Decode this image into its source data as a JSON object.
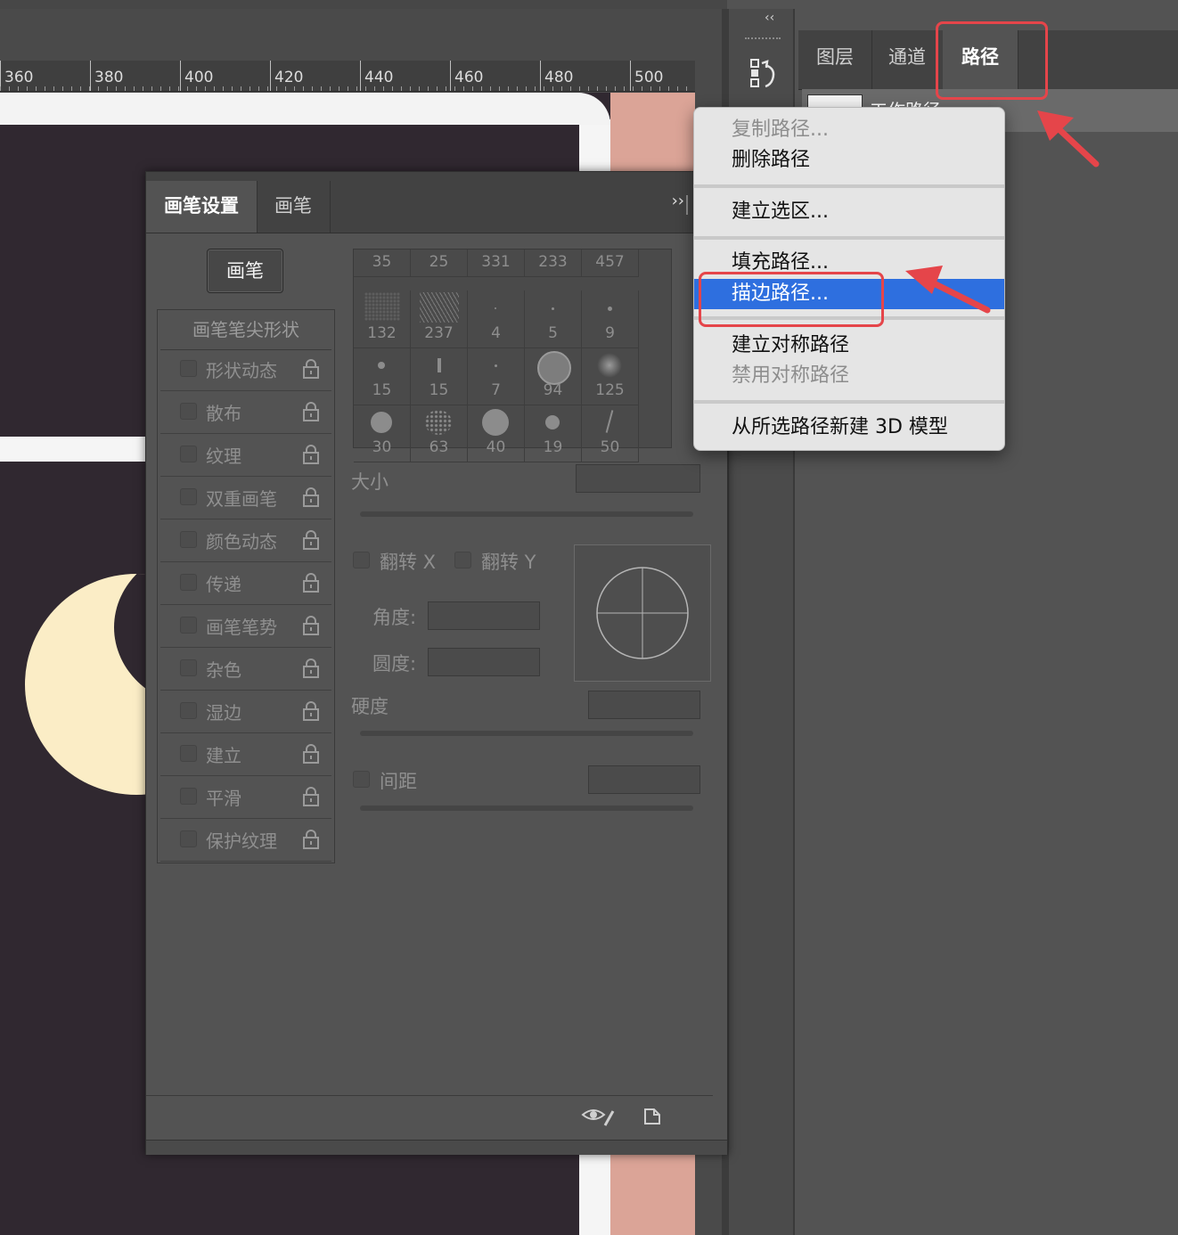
{
  "ruler": {
    "labels": [
      "360",
      "380",
      "400",
      "420",
      "440",
      "460",
      "480",
      "500"
    ]
  },
  "right_panel": {
    "collapse_glyph": "‹‹",
    "history_icon": "history-icon",
    "tabs": [
      {
        "label": "图层"
      },
      {
        "label": "通道"
      },
      {
        "label": "路径",
        "active": true
      }
    ],
    "path_item": "工作路径"
  },
  "brush_panel": {
    "tabs": [
      {
        "label": "画笔设置",
        "active": true
      },
      {
        "label": "画笔"
      }
    ],
    "more_glyph": "››",
    "brushes_button": "画笔",
    "tip_shape_header": "画笔笔尖形状",
    "options": [
      "形状动态",
      "散布",
      "纹理",
      "双重画笔",
      "颜色动态",
      "传递",
      "画笔笔势",
      "杂色",
      "湿边",
      "建立",
      "平滑",
      "保护纹理"
    ],
    "presets": [
      "35",
      "25",
      "331",
      "233",
      "457",
      "132",
      "237",
      "4",
      "5",
      "9",
      "15",
      "15",
      "7",
      "94",
      "125",
      "30",
      "63",
      "40",
      "19",
      "50"
    ],
    "size_label": "大小",
    "flip_x_label": "翻转 X",
    "flip_y_label": "翻转 Y",
    "angle_label": "角度:",
    "roundness_label": "圆度:",
    "hardness_label": "硬度",
    "spacing_label": "间距"
  },
  "context_menu": {
    "items": [
      {
        "label": "复制路径...",
        "state": "disabled"
      },
      {
        "label": "删除路径",
        "state": "normal"
      },
      {
        "label": "建立选区...",
        "state": "normal"
      },
      {
        "label": "填充路径...",
        "state": "normal"
      },
      {
        "label": "描边路径...",
        "state": "selected"
      },
      {
        "label": "建立对称路径",
        "state": "normal"
      },
      {
        "label": "禁用对称路径",
        "state": "disabled"
      },
      {
        "label": "从所选路径新建 3D 模型",
        "state": "normal"
      }
    ]
  },
  "colors": {
    "highlight": "#2e6fdf",
    "annotation": "#e5454a",
    "canvas": "#302830",
    "moon": "#fbedc6",
    "pink": "#dba497"
  }
}
